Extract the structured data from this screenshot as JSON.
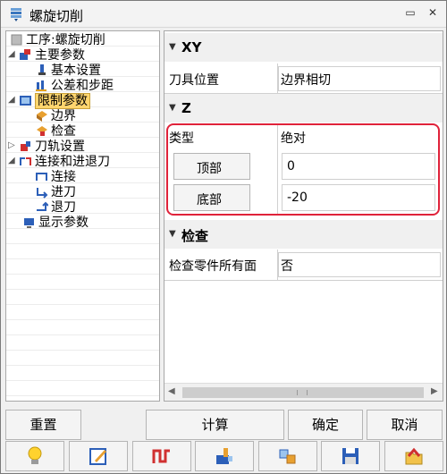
{
  "window": {
    "title": "螺旋切削"
  },
  "tree": {
    "items": [
      {
        "label": "工序:螺旋切削"
      },
      {
        "label": "主要参数"
      },
      {
        "label": "基本设置"
      },
      {
        "label": "公差和步距"
      },
      {
        "label": "限制参数"
      },
      {
        "label": "边界"
      },
      {
        "label": "检查"
      },
      {
        "label": "刀轨设置"
      },
      {
        "label": "连接和进退刀"
      },
      {
        "label": "连接"
      },
      {
        "label": "进刀"
      },
      {
        "label": "退刀"
      },
      {
        "label": "显示参数"
      }
    ]
  },
  "grid": {
    "sections": [
      {
        "title": "XY"
      },
      {
        "title": "Z"
      },
      {
        "title": "检查"
      }
    ],
    "xy_rows": [
      {
        "key": "刀具位置",
        "value": "边界相切"
      }
    ],
    "z_rows": [
      {
        "key": "类型",
        "value": "绝对"
      },
      {
        "key": "顶部",
        "value": "0"
      },
      {
        "key": "底部",
        "value": "-20"
      }
    ],
    "check_rows": [
      {
        "key": "检查零件所有面",
        "value": "否"
      }
    ]
  },
  "buttons": {
    "reset": "重置",
    "compute": "计算",
    "ok": "确定",
    "cancel": "取消"
  },
  "icons": [
    "lightbulb-icon",
    "edit-icon",
    "toolpath-icon",
    "simulate-icon",
    "settings-icon",
    "save-icon",
    "load-icon"
  ],
  "colors": {
    "highlight": "#e0223a",
    "selected": "#ffd56e"
  }
}
